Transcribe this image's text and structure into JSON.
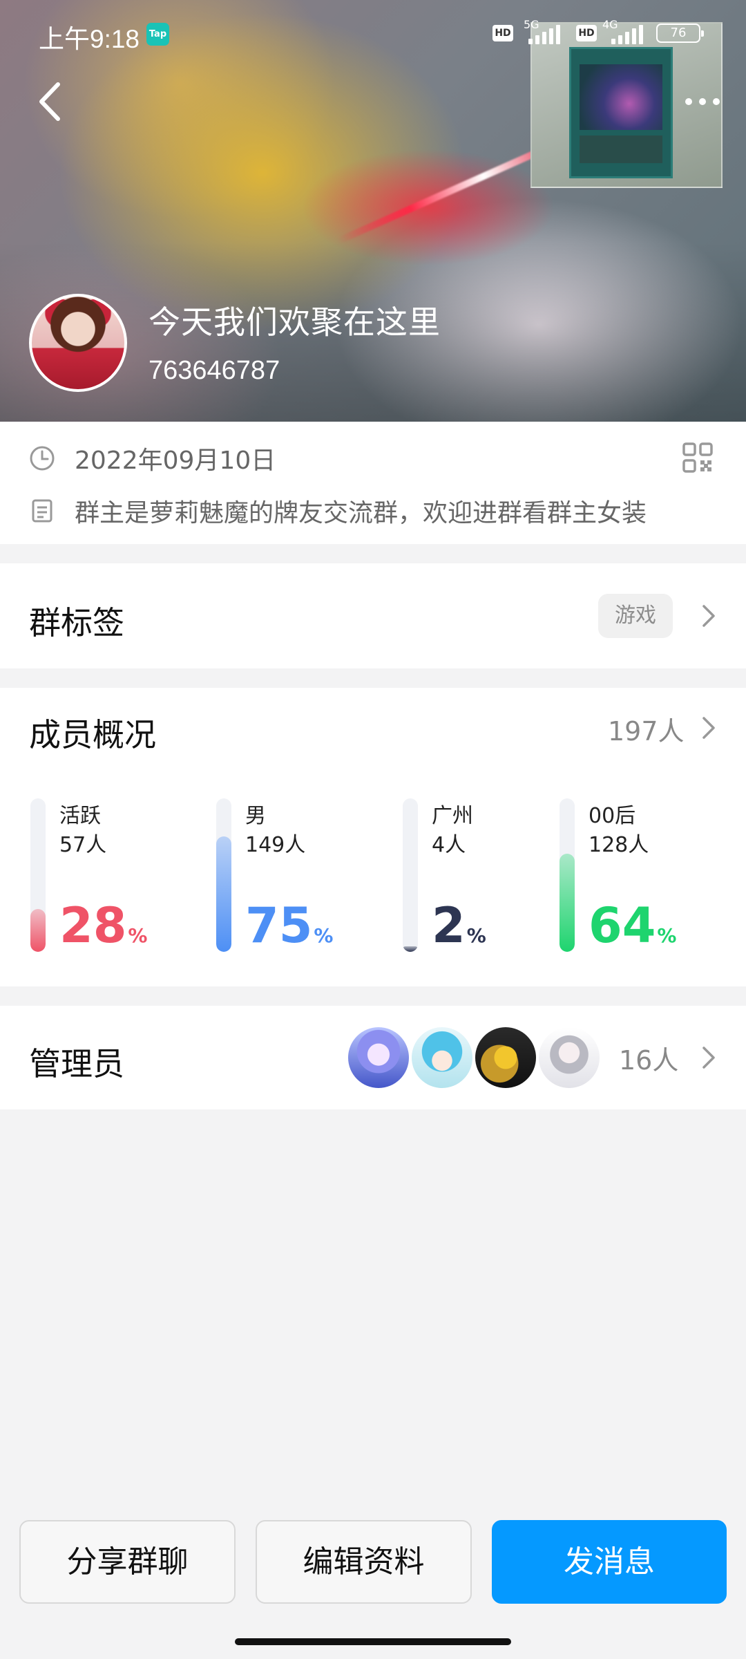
{
  "status_bar": {
    "time": "上午9:18",
    "app_badge": "Tap",
    "hd1": "HD",
    "net1": "5G",
    "hd2": "HD",
    "net2": "4G",
    "battery": "76"
  },
  "header": {
    "group_name": "今天我们欢聚在这里",
    "group_id": "763646787"
  },
  "info": {
    "created_date": "2022年09月10日",
    "description": "群主是萝莉魅魔的牌友交流群，欢迎进群看群主女装"
  },
  "tags": {
    "title": "群标签",
    "tag": "游戏"
  },
  "members": {
    "title": "成员概况",
    "total": "197人",
    "stats": [
      {
        "label": "活跃",
        "count": "57人",
        "percent": "28",
        "pct_sign": "%",
        "fill": 0.28,
        "color": "#ef5367"
      },
      {
        "label": "男",
        "count": "149人",
        "percent": "75",
        "pct_sign": "%",
        "fill": 0.75,
        "color": "#4d8ff5"
      },
      {
        "label": "广州",
        "count": "4人",
        "percent": "2",
        "pct_sign": "%",
        "fill": 0.02,
        "color": "#2d3552"
      },
      {
        "label": "00后",
        "count": "128人",
        "percent": "64",
        "pct_sign": "%",
        "fill": 0.64,
        "color": "#1ed46e"
      }
    ]
  },
  "admins": {
    "title": "管理员",
    "count": "16人"
  },
  "actions": {
    "share": "分享群聊",
    "edit": "编辑资料",
    "message": "发消息"
  }
}
